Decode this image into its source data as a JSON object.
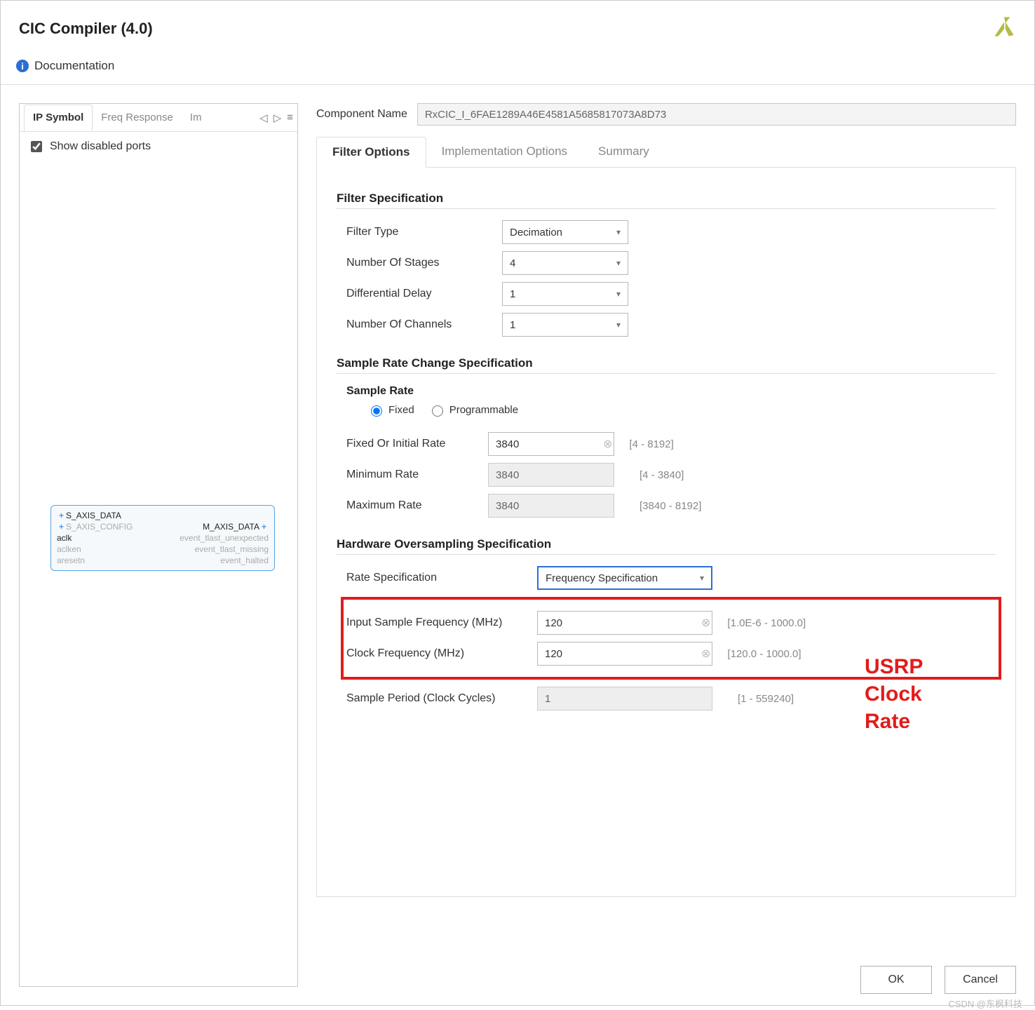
{
  "header": {
    "title": "CIC Compiler (4.0)",
    "documentation": "Documentation",
    "logo_color": "#b5bb44"
  },
  "left": {
    "tabs": [
      "IP Symbol",
      "Freq Response",
      "Im"
    ],
    "show_disabled": "Show disabled ports",
    "ip_block": {
      "in": [
        "S_AXIS_DATA",
        "S_AXIS_CONFIG",
        "aclk",
        "aclken",
        "aresetn"
      ],
      "out": [
        "M_AXIS_DATA",
        "event_tlast_unexpected",
        "event_tlast_missing",
        "event_halted"
      ]
    }
  },
  "right": {
    "comp_name_label": "Component Name",
    "comp_name": "RxCIC_I_6FAE1289A46E4581A5685817073A8D73",
    "tabs": [
      "Filter Options",
      "Implementation Options",
      "Summary"
    ],
    "filter_spec": {
      "heading": "Filter Specification",
      "filter_type_label": "Filter Type",
      "filter_type": "Decimation",
      "num_stages_label": "Number Of Stages",
      "num_stages": "4",
      "diff_delay_label": "Differential Delay",
      "diff_delay": "1",
      "num_channels_label": "Number Of Channels",
      "num_channels": "1"
    },
    "rate_spec": {
      "heading": "Sample Rate Change Specification",
      "subheading": "Sample Rate",
      "radio_fixed": "Fixed",
      "radio_prog": "Programmable",
      "fixed_rate_label": "Fixed Or Initial Rate",
      "fixed_rate": "3840",
      "fixed_rate_hint": "[4 - 8192]",
      "min_rate_label": "Minimum Rate",
      "min_rate": "3840",
      "min_rate_hint": "[4 - 3840]",
      "max_rate_label": "Maximum Rate",
      "max_rate": "3840",
      "max_rate_hint": "[3840 - 8192]"
    },
    "hw_spec": {
      "heading": "Hardware Oversampling Specification",
      "rate_spec_label": "Rate Specification",
      "rate_spec": "Frequency Specification",
      "isf_label": "Input Sample Frequency (MHz)",
      "isf": "120",
      "isf_hint": "[1.0E-6 - 1000.0]",
      "clk_label": "Clock Frequency (MHz)",
      "clk": "120",
      "clk_hint": "[120.0 - 1000.0]",
      "period_label": "Sample Period (Clock Cycles)",
      "period": "1",
      "period_hint": "[1 - 559240]"
    },
    "callout": "USRP Clock Rate"
  },
  "footer": {
    "ok": "OK",
    "cancel": "Cancel"
  },
  "watermark": "CSDN @东枫科技"
}
